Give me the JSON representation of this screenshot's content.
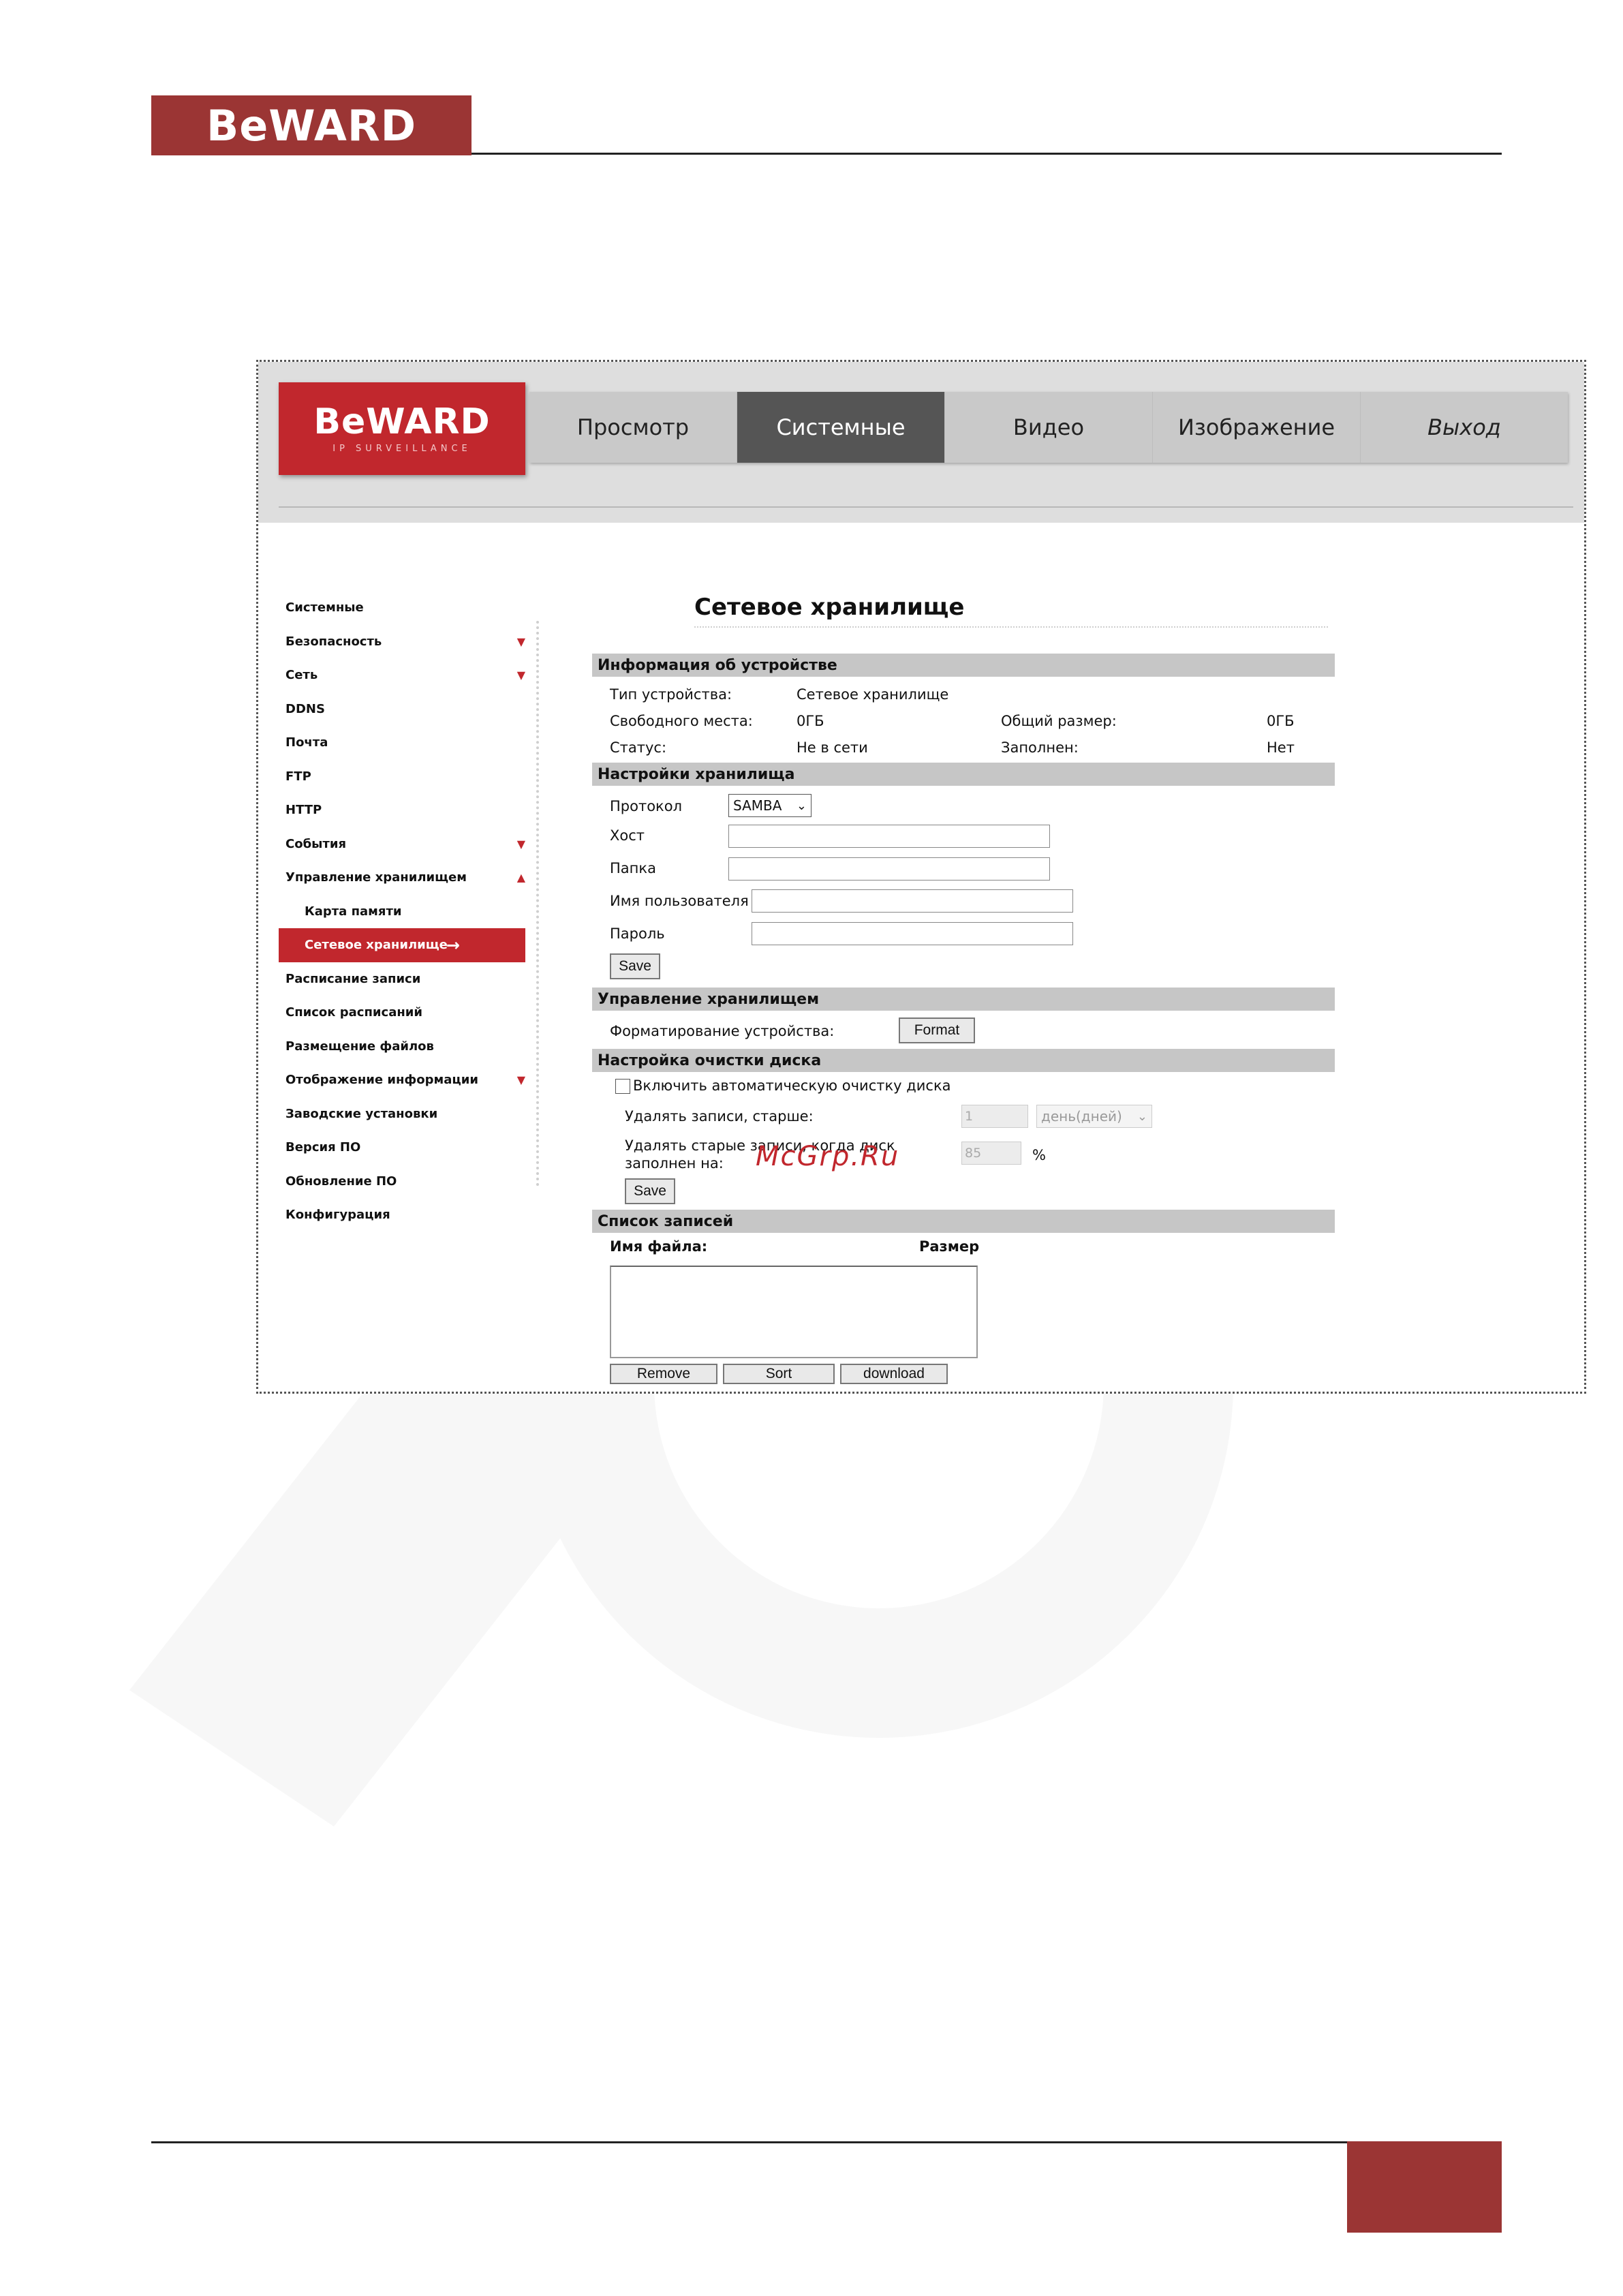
{
  "page": {
    "logo_text": "BeWARD",
    "accent_color": "#9b3534"
  },
  "app": {
    "logo_text": "BeWARD",
    "logo_subtext": "IP SURVEILLANCE",
    "brand_color": "#c1272d",
    "nav": [
      {
        "label": "Просмотр"
      },
      {
        "label": "Системные",
        "active": true
      },
      {
        "label": "Видео"
      },
      {
        "label": "Изображение"
      },
      {
        "label": "Выход"
      }
    ]
  },
  "sidebar": {
    "items": [
      {
        "label": "Системные"
      },
      {
        "label": "Безопасность",
        "arrow": "▼"
      },
      {
        "label": "Сеть",
        "arrow": "▼"
      },
      {
        "label": "DDNS"
      },
      {
        "label": "Почта"
      },
      {
        "label": "FTP"
      },
      {
        "label": "HTTP"
      },
      {
        "label": "События",
        "arrow": "▼"
      },
      {
        "label": "Управление хранилищем",
        "arrow": "▲"
      },
      {
        "label": "Карта памяти",
        "sub": true
      },
      {
        "label": "Сетевое хранилище",
        "sub": true,
        "active": true,
        "arrow": "→"
      },
      {
        "label": "Расписание записи"
      },
      {
        "label": "Список расписаний"
      },
      {
        "label": "Размещение файлов"
      },
      {
        "label": "Отображение информации",
        "arrow": "▼"
      },
      {
        "label": "Заводские установки"
      },
      {
        "label": "Версия ПО"
      },
      {
        "label": "Обновление ПО"
      },
      {
        "label": "Конфигурация"
      }
    ]
  },
  "main": {
    "title": "Сетевое хранилище",
    "device_info": {
      "header": "Информация об устройстве",
      "type_label": "Тип устройства:",
      "type_value": "Сетевое хранилище",
      "free_label": "Свободного места:",
      "free_value": "0ГБ",
      "total_label": "Общий размер:",
      "total_value": "0ГБ",
      "status_label": "Статус:",
      "status_value": "Не в сети",
      "full_label": "Заполнен:",
      "full_value": "Нет"
    },
    "storage_settings": {
      "header": "Настройки хранилища",
      "protocol_label": "Протокол",
      "protocol_value": "SAMBA",
      "host_label": "Хост",
      "host_value": "",
      "folder_label": "Папка",
      "folder_value": "",
      "user_label": "Имя пользователя",
      "user_value": "",
      "password_label": "Пароль",
      "password_value": "",
      "save_label": "Save"
    },
    "storage_management": {
      "header": "Управление хранилищем",
      "format_label": "Форматирование устройства:",
      "format_button": "Format"
    },
    "disk_cleanup": {
      "header": "Настройка очистки диска",
      "auto_clean_label": "Включить автоматическую очистку диска",
      "auto_clean_checked": false,
      "older_label": "Удалять записи, старше:",
      "older_value": "1",
      "older_unit": "день(дней)",
      "full_label_line1": "Удалять старые записи, когда диск",
      "full_label_line2": "заполнен на:",
      "full_value": "85",
      "percent_sign": "%",
      "save_label": "Save"
    },
    "records": {
      "header": "Список записей",
      "col_filename": "Имя файла:",
      "col_size": "Размер",
      "items": [],
      "remove_label": "Remove",
      "sort_label": "Sort",
      "download_label": "download"
    }
  },
  "watermark_text": "McGrp.Ru"
}
